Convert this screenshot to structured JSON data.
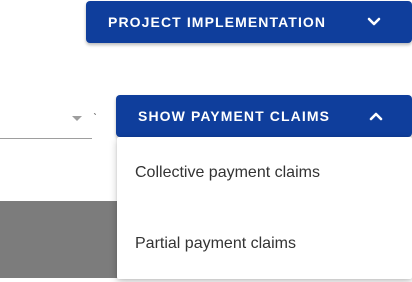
{
  "header": {
    "project_button_label": "PROJECT IMPLEMENTATION",
    "project_chevron": "chevron-down-icon"
  },
  "filters": {
    "select_value": "",
    "select_icon": "caret-down-icon"
  },
  "claims": {
    "button_label": "SHOW PAYMENT CLAIMS",
    "chevron": "chevron-up-icon",
    "menu_items": [
      {
        "label": "Collective payment claims"
      },
      {
        "label": "Partial payment claims"
      }
    ]
  },
  "colors": {
    "primary": "#0f3e9c",
    "button_text": "#ffffff",
    "menu_text": "#333333",
    "overlay_gray": "#7c7c7c"
  }
}
